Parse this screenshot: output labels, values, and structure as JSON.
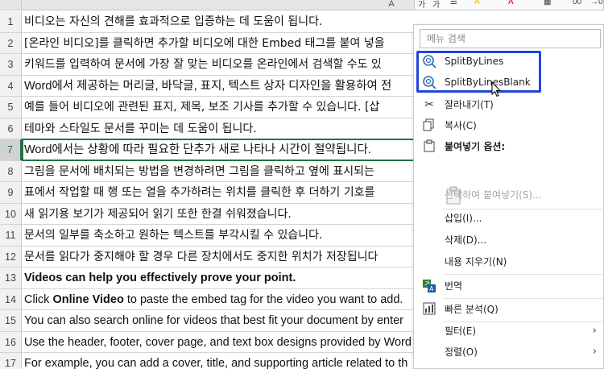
{
  "sheet": {
    "column_letter": "A",
    "rows": [
      {
        "num": "1",
        "text": "비디오는 자신의 견해를 효과적으로 입증하는 데 도움이 됩니다."
      },
      {
        "num": "2",
        "text": "[온라인 비디오]를 클릭하면 추가할 비디오에 대한 Embed 태그를 붙여 넣을"
      },
      {
        "num": "3",
        "text": "키워드를 입력하여 문서에 가장 잘 맞는 비디오를 온라인에서 검색할 수도 있"
      },
      {
        "num": "4",
        "text": "Word에서 제공하는 머리글, 바닥글, 표지, 텍스트 상자 디자인을 활용하여 전"
      },
      {
        "num": "5",
        "text": "예를 들어 비디오에 관련된 표지, 제목, 보조 기사를 추가할 수 있습니다. [삽"
      },
      {
        "num": "6",
        "text": "테마와 스타일도 문서를 꾸미는 데 도움이 됩니다."
      },
      {
        "num": "7",
        "text": "Word에서는 상황에 따라 필요한 단추가 새로 나타나 시간이 절약됩니다."
      },
      {
        "num": "8",
        "text": "그림을 문서에 배치되는 방법을 변경하려면 그림을 클릭하고 옆에 표시되는"
      },
      {
        "num": "9",
        "text": "표에서 작업할 때 행 또는 열을 추가하려는 위치를 클릭한 후 더하기 기호를"
      },
      {
        "num": "10",
        "text": "새 읽기용 보기가 제공되어 읽기 또한 한결 쉬워졌습니다."
      },
      {
        "num": "11",
        "text": "문서의 일부를 축소하고 원하는 텍스트를 부각시킬 수 있습니다."
      },
      {
        "num": "12",
        "text": "문서를 읽다가 중지해야 할 경우 다른 장치에서도 중지한 위치가 저장됩니다"
      },
      {
        "num": "13",
        "text": "Videos can help you effectively prove your point."
      },
      {
        "num": "14",
        "pre": "Click ",
        "bold": "Online Video",
        "post": " to paste the embed tag for the video you want to add."
      },
      {
        "num": "15",
        "text": "You can also search online for videos that best fit your document by enter"
      },
      {
        "num": "16",
        "text": "Use the header, footer, cover page, and text box designs provided by Word"
      },
      {
        "num": "17",
        "text": "For example, you can add a cover, title, and supporting article related to th"
      }
    ]
  },
  "mini_toolbar": {
    "items": [
      "가",
      "가",
      "☰",
      "A",
      "▦",
      "00",
      "→0"
    ]
  },
  "context_menu": {
    "search_placeholder": "메뉴 검색",
    "items": {
      "split_by_lines": "SplitByLines",
      "split_by_lines_blank": "SplitByLinesBlank",
      "cut": "잘라내기(T)",
      "copy": "복사(C)",
      "paste_options": "붙여넣기 옵션:",
      "paste_special": "선택하여 붙여넣기(S)...",
      "insert": "삽입(I)...",
      "delete": "삭제(D)...",
      "clear_contents": "내용 지우기(N)",
      "translate": "번역",
      "quick_analysis": "빠른 분석(Q)",
      "filter": "필터(E)",
      "sort": "정렬(O)"
    }
  },
  "colors": {
    "highlight_box": "#2346d6",
    "excel_green": "#217346"
  }
}
